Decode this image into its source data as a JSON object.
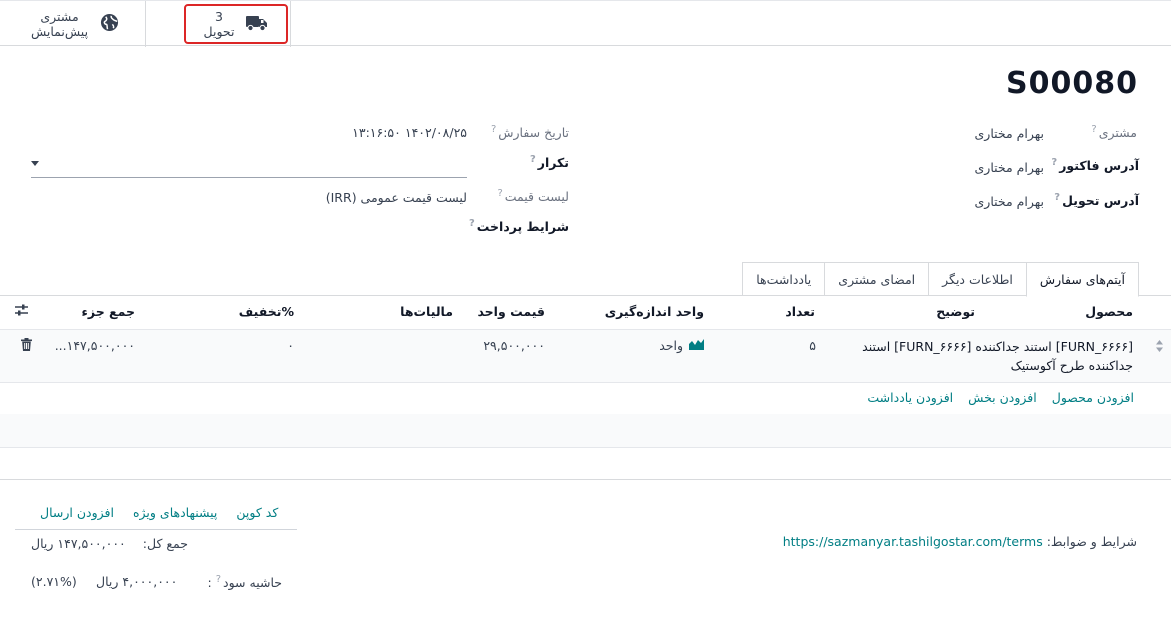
{
  "smart_buttons": {
    "delivery": {
      "count": "3",
      "label": "تحویل",
      "icon": "truck-icon"
    },
    "preview": {
      "line1": "مشتری",
      "line2": "پیش‌نمایش",
      "icon": "globe-icon"
    }
  },
  "record_title": "S00080",
  "fields": {
    "customer": {
      "label": "مشتری",
      "value": "بهرام مختاری"
    },
    "invoice_address": {
      "label": "آدرس فاکتور",
      "value": "بهرام مختاری"
    },
    "delivery_address": {
      "label": "آدرس تحویل",
      "value": "بهرام مختاری"
    },
    "order_date": {
      "label": "تاریخ سفارش",
      "value": "۱۴۰۲/۰۸/۲۵ ۱۳:۱۶:۵۰"
    },
    "recurrence": {
      "label": "تکرار",
      "value": ""
    },
    "pricelist": {
      "label": "لیست قیمت",
      "value": "لیست قیمت عمومی (IRR)"
    },
    "payment_terms": {
      "label": "شرایط پرداخت",
      "value": ""
    }
  },
  "tabs": [
    {
      "label": "آیتم‌های سفارش",
      "active": true
    },
    {
      "label": "اطلاعات دیگر",
      "active": false
    },
    {
      "label": "امضای مشتری",
      "active": false
    },
    {
      "label": "یادداشت‌ها",
      "active": false
    }
  ],
  "table": {
    "columns": {
      "product": "محصول",
      "description": "توضیح",
      "quantity": "تعداد",
      "uom": "واحد اندازه‌گیری",
      "unit_price": "قیمت واحد",
      "taxes": "مالیات‌ها",
      "discount": "تخفیف%",
      "subtotal": "جمع جزء"
    },
    "rows": [
      {
        "description_line1": "[FURN_۶۶۶۶] استند جداکننده [FURN_۶۶۶۶] استند",
        "description_line2": "جداکننده طرح آکوستیک",
        "quantity": "۵",
        "uom": "واحد",
        "unit_price": "۲۹,۵۰۰,۰۰۰",
        "taxes": "",
        "discount": "۰",
        "subtotal": "۱۴۷,۵۰۰,۰۰۰..."
      }
    ],
    "add_links": {
      "add_product": "افزودن محصول",
      "add_section": "افزودن بخش",
      "add_note": "افزودن یادداشت"
    }
  },
  "footer": {
    "actions": {
      "coupon": "کد کوپن",
      "promotions": "پیشنهادهای ویژه",
      "add_shipping": "افزودن ارسال"
    },
    "total_label": "جمع کل:",
    "total_value": "۱۴۷,۵۰۰,۰۰۰ ریال",
    "margin_label": "حاشیه سود",
    "margin_value": "۴,۰۰۰,۰۰۰ ریال",
    "margin_percent": "(۲.۷۱%)",
    "terms_label": "شرایط و ضوابط:",
    "terms_url": "https://sazmanyar.tashilgostar.com/terms"
  },
  "colors": {
    "accent": "#017e84",
    "highlight_border": "#dc2626"
  }
}
